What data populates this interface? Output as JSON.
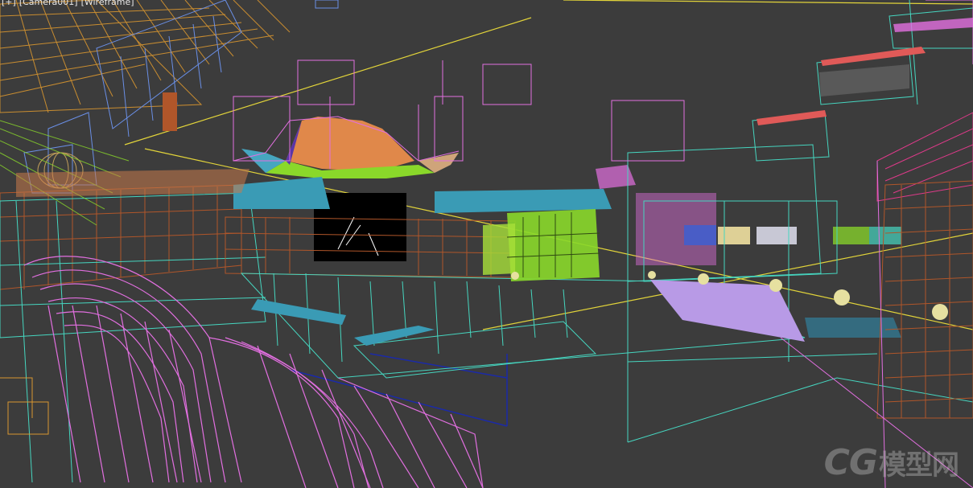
{
  "viewport": {
    "label_segments": [
      "[+]",
      "[Camera001]",
      "[Wireframe]"
    ],
    "watermark_main": "CG",
    "watermark_sub": "模型网"
  },
  "colors": {
    "background": "#3c3c3c",
    "roof_orange": "#e0884a",
    "roof_teal": "#3a9bb5",
    "pink_wire": "#e26fe0",
    "orange_wire": "#d9962f",
    "brown_wire": "#b0562a",
    "green_wire": "#8ad82a",
    "cyan_wire": "#46d6c0",
    "yellow_line": "#e2d43a",
    "blue_wire": "#6a8fe6",
    "lavender_plane": "#b89ae6",
    "dark_navy_line": "#1b2aa8"
  }
}
